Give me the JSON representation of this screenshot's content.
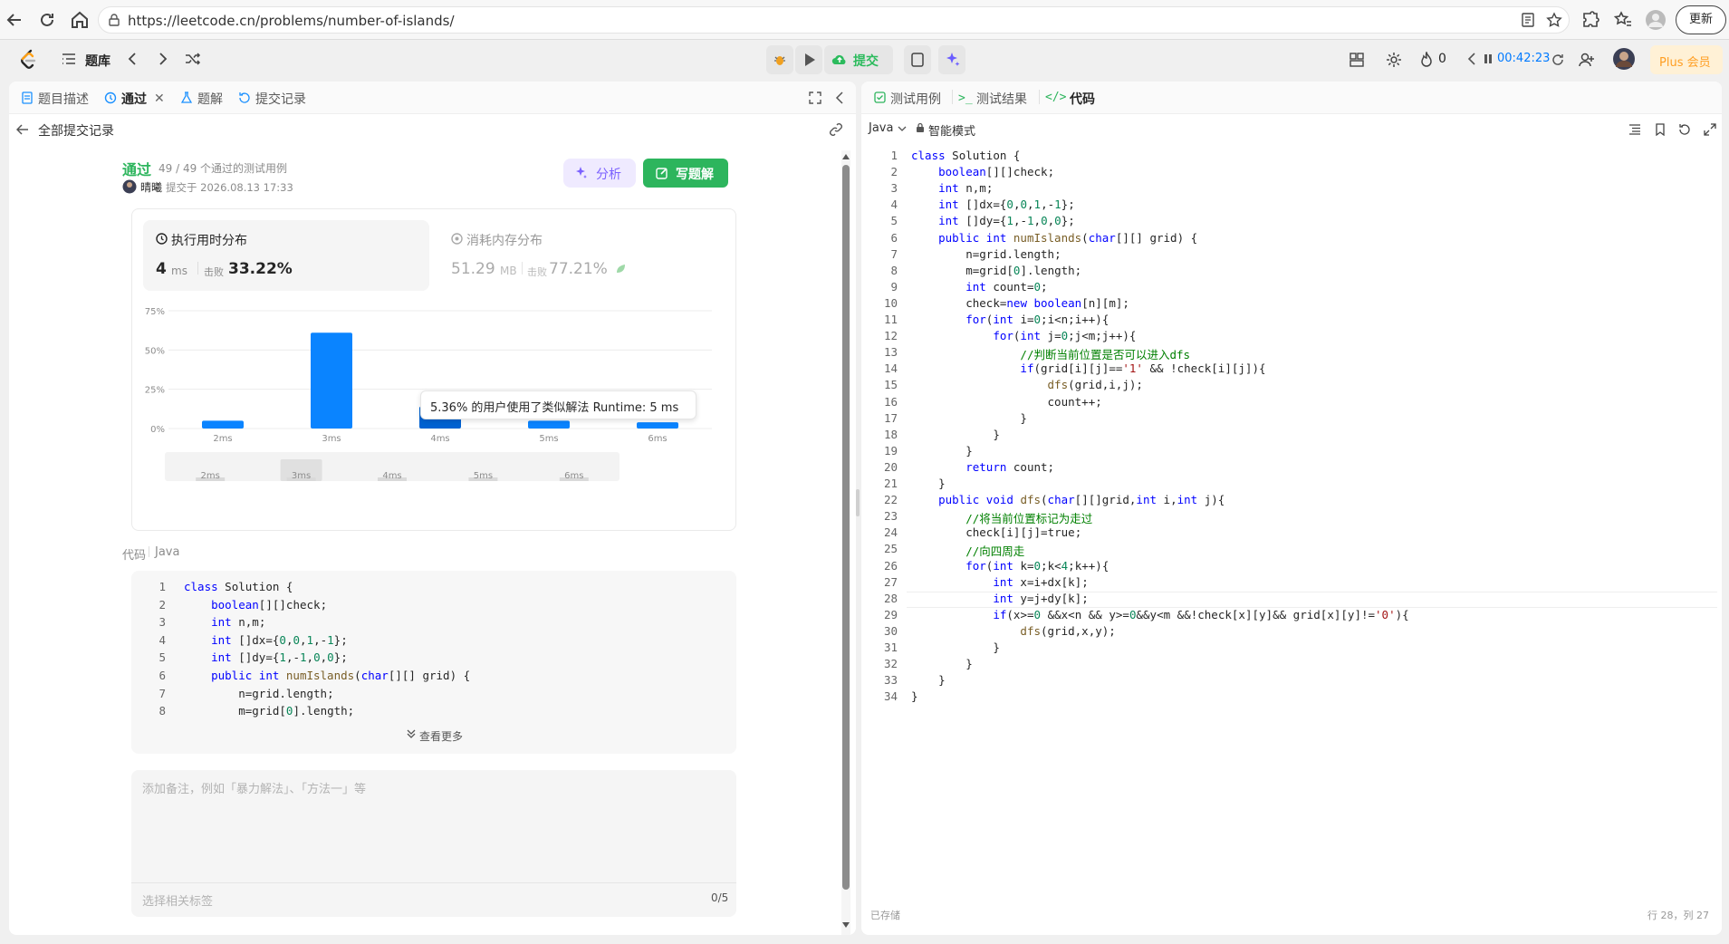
{
  "browser": {
    "url": "https://leetcode.cn/problems/number-of-islands/",
    "update_label": "更新"
  },
  "header": {
    "problem_bank": "题库",
    "submit_label": "提交",
    "fire_count": "0",
    "timer": "00:42:23",
    "plus_label": "Plus 会员"
  },
  "left_tabs": [
    "题目描述",
    "通过",
    "题解",
    "提交记录"
  ],
  "back_label": "全部提交记录",
  "submission": {
    "status": "通过",
    "passed_text": "49 / 49 个通过的测试用例",
    "user": "晴曦",
    "submitted_at": "提交于 2026.08.13 17:33",
    "analyze_label": "分析",
    "write_solution_label": "写题解"
  },
  "runtime": {
    "title": "执行用时分布",
    "value": "4",
    "unit": "ms",
    "beats_label": "击败",
    "beats": "33.22%"
  },
  "memory": {
    "title": "消耗内存分布",
    "value": "51.29",
    "unit": "MB",
    "beats_label": "击败",
    "beats": "77.21%"
  },
  "tooltip": "5.36% 的用户使用了类似解法 Runtime: 5 ms",
  "chart_data": {
    "type": "bar",
    "categories": [
      "2ms",
      "3ms",
      "4ms",
      "5ms",
      "6ms"
    ],
    "values": [
      5,
      61,
      14,
      5,
      4
    ],
    "ylim": [
      0,
      75
    ],
    "yticks": [
      "75%",
      "50%",
      "25%",
      "0%"
    ],
    "highlight": "4ms",
    "color": "#0a84ff",
    "highlight_color": "#0062d1"
  },
  "code_section": {
    "label": "代码",
    "lang": "Java",
    "see_more": "查看更多",
    "lines": [
      "class Solution {",
      "    boolean[][]check;",
      "    int n,m;",
      "    int []dx={0,0,1,-1};",
      "    int []dy={1,-1,0,0};",
      "    public int numIslands(char[][] grid) {",
      "        n=grid.length;",
      "        m=grid[0].length;"
    ]
  },
  "notes": {
    "placeholder": "添加备注，例如「暴力解法」、「方法一」等",
    "tags_placeholder": "选择相关标签",
    "tags_count": "0/5"
  },
  "right_tabs": [
    "测试用例",
    "测试结果",
    "代码"
  ],
  "editor": {
    "lang": "Java",
    "mode": "智能模式",
    "saved": "已存储",
    "cursor": "行 28，列 27",
    "lines": [
      "class Solution {",
      "    boolean[][]check;",
      "    int n,m;",
      "    int []dx={0,0,1,-1};",
      "    int []dy={1,-1,0,0};",
      "    public int numIslands(char[][] grid) {",
      "        n=grid.length;",
      "        m=grid[0].length;",
      "        int count=0;",
      "        check=new boolean[n][m];",
      "        for(int i=0;i<n;i++){",
      "            for(int j=0;j<m;j++){",
      "                //判断当前位置是否可以进入dfs",
      "                if(grid[i][j]=='1' && !check[i][j]){",
      "                    dfs(grid,i,j);",
      "                    count++;",
      "                }",
      "            }",
      "        }",
      "        return count;",
      "    }",
      "    public void dfs(char[][]grid,int i,int j){",
      "        //将当前位置标记为走过",
      "        check[i][j]=true;",
      "        //向四周走",
      "        for(int k=0;k<4;k++){",
      "            int x=i+dx[k];",
      "            int y=j+dy[k];",
      "            if(x>=0 &&x<n && y>=0&&y<m &&!check[x][y]&& grid[x][y]!='0'){",
      "                dfs(grid,x,y);",
      "            }",
      "        }",
      "    }",
      "}"
    ]
  }
}
